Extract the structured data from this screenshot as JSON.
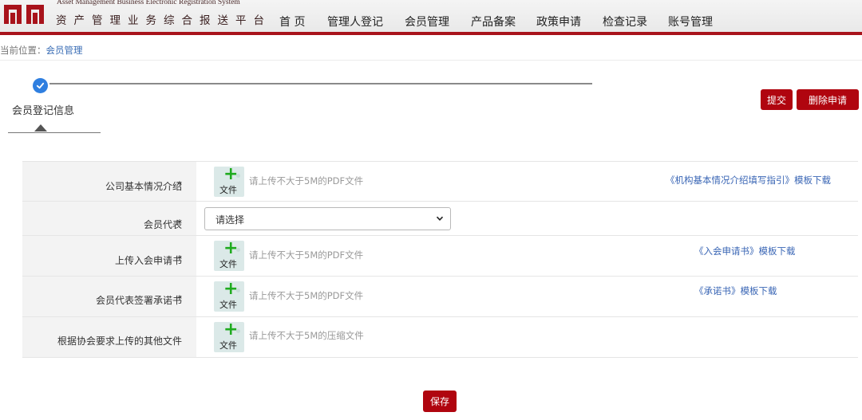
{
  "header": {
    "title_en": "Asset Management Business Electronic Registration System",
    "title_cn": "资产管理业务综合报送平台",
    "nav": [
      "首 页",
      "管理人登记",
      "会员管理",
      "产品备案",
      "政策申请",
      "检查记录",
      "账号管理"
    ]
  },
  "breadcrumb": {
    "prefix": "当前位置：",
    "current": "会员管理"
  },
  "stepper": {
    "step_label": "会员登记信息"
  },
  "actions": {
    "submit": "提交",
    "delete": "删除申请",
    "save": "保存"
  },
  "form": {
    "upload_button": "文件",
    "rows": [
      {
        "label": "公司基本情况介绍",
        "required": "*",
        "hint": "请上传不大于5M的PDF文件",
        "template": "《机构基本情况介绍填写指引》模板下载"
      },
      {
        "label": "会员代表",
        "required": "*",
        "select_value": "请选择"
      },
      {
        "label": "上传入会申请书",
        "required": "*",
        "hint": "请上传不大于5M的PDF文件",
        "template": "《入会申请书》模板下载"
      },
      {
        "label": "会员代表签署承诺书",
        "required": "*",
        "hint": "请上传不大于5M的PDF文件",
        "template": "《承诺书》模板下载"
      },
      {
        "label": "根据协会要求上传的其他文件",
        "hint": "请上传不大于5M的压缩文件"
      }
    ]
  },
  "colors": {
    "brand_red": "#b0050f",
    "link_blue": "#3a66b5",
    "step_blue": "#2f7fe0",
    "plus_green": "#1fab1f"
  }
}
